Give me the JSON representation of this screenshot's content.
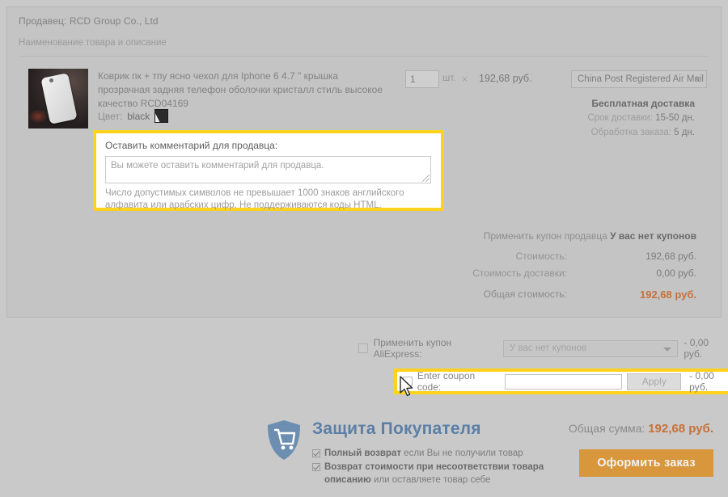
{
  "card": {
    "seller_line": "Продавец: RCD Group Co., Ltd",
    "column_header": "Наименование товара и описание"
  },
  "product": {
    "title": "Коврик пк + тпу ясно чехол для Iphone 6 4.7 \" крышка прозрачная задняя телефон оболочки кристалл стиль высокое качество RCD04169",
    "color_label": "Цвет:",
    "color_value": "black",
    "quantity": "1",
    "unit_label": "шт.",
    "multiply_symbol": "×",
    "unit_price": "192,68 руб."
  },
  "shipping": {
    "method": "China Post Registered Air Mail",
    "free_label": "Бесплатная доставка",
    "delivery_label": "Срок доставки:",
    "delivery_value": "15-50 дн.",
    "processing_label": "Обработка заказа:",
    "processing_value": "5 дн."
  },
  "comment": {
    "label": "Оставить комментарий для продавца:",
    "placeholder": "Вы можете оставить комментарий для продавца.",
    "value": "",
    "hint": "Число допустимых символов не превышает 1000 знаков английского алфавита или арабских цифр. Не поддерживаются коды HTML."
  },
  "seller_coupon": {
    "label": "Применить купон продавца",
    "status": "У вас нет купонов"
  },
  "totals": [
    {
      "label": "Стоимость:",
      "amount": "192,68 руб."
    },
    {
      "label": "Стоимость доставки:",
      "amount": "0,00 руб."
    },
    {
      "label": "Общая стоимость:",
      "amount": "192,68 руб."
    }
  ],
  "ae_coupon": {
    "label": "Применить купон AliExpress:",
    "selected": "У вас нет купонов",
    "discount": "- 0,00 руб."
  },
  "enter_coupon": {
    "label": "Enter coupon code:",
    "value": "",
    "apply_label": "Apply",
    "discount": "- 0,00 руб."
  },
  "buyer_protection": {
    "title": "Защита Покупателя",
    "items": [
      {
        "strong": "Полный возврат",
        "rest": " если Вы не получили товар"
      },
      {
        "strong": "Возврат стоимости при несоответствии товара описанию",
        "rest": " или оставляете товар себе"
      }
    ]
  },
  "footer": {
    "grand_total_label": "Общая сумма:",
    "grand_total_value": "192,68 руб.",
    "place_order_label": "Оформить заказ"
  },
  "colors": {
    "highlight": "#ffd21e",
    "accent_price": "#c7703a",
    "button": "#d8973c",
    "protection_blue": "#5b7fa6"
  }
}
